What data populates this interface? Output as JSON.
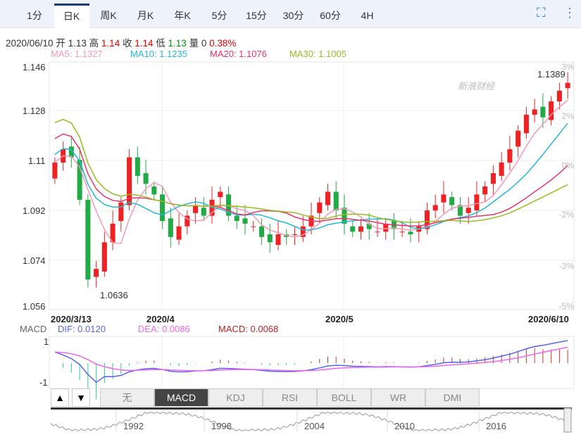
{
  "tabs": [
    "1分",
    "日K",
    "周K",
    "月K",
    "年K",
    "5分",
    "15分",
    "30分",
    "60分",
    "4H"
  ],
  "active_tab": "日K",
  "info": {
    "date": "2020/06/10",
    "open_label": "开",
    "open": "1.13",
    "high_label": "高",
    "high": "1.14",
    "close_label": "收",
    "close": "1.14",
    "low_label": "低",
    "low": "1.13",
    "vol_label": "量",
    "vol": "0",
    "change": "0.38%"
  },
  "ma": {
    "ma5": "MA5: 1.1327",
    "ma10": "MA10: 1.1235",
    "ma20": "MA20: 1.1076",
    "ma30": "MA30: 1.1005"
  },
  "watermark": "新浪财经",
  "colors": {
    "up": "#ee2222",
    "down": "#22aa44",
    "ma5": "#f49ab8",
    "ma10": "#22b8d8",
    "ma20": "#e8336a",
    "ma30": "#99bb22",
    "dif": "#5566ee",
    "dea": "#ee66ee"
  },
  "macd": {
    "label": "MACD",
    "dif": "DIF: 0.0120",
    "dea": "DEA: 0.0086",
    "macd": "MACD: 0.0068",
    "tick_top": "1",
    "tick_bottom": "-1"
  },
  "indicator_tabs": [
    "无",
    "MACD",
    "KDJ",
    "RSI",
    "BOLL",
    "WR",
    "DMI"
  ],
  "nav_years": [
    "1992",
    "1998",
    "2004",
    "2010",
    "2016"
  ],
  "chart_data": {
    "type": "candlestick",
    "y_ticks": [
      "1.146",
      "1.128",
      "1.11",
      "1.092",
      "1.074",
      "1.056"
    ],
    "y_pct_ticks": [
      "3%",
      "2%",
      "0%",
      "-2%",
      "-3%",
      "-5%"
    ],
    "ylim": [
      1.056,
      1.146
    ],
    "x_labels": [
      "2020/3/13",
      "2020/4",
      "2020/5",
      "2020/6/10"
    ],
    "max_label": "1.1389",
    "min_label": "1.0636",
    "closes": [
      1.11,
      1.115,
      1.112,
      1.096,
      1.066,
      1.07,
      1.08,
      1.087,
      1.095,
      1.112,
      1.105,
      1.102,
      1.098,
      1.088,
      1.082,
      1.086,
      1.09,
      1.094,
      1.09,
      1.096,
      1.099,
      1.09,
      1.088,
      1.087,
      1.086,
      1.082,
      1.08,
      1.083,
      1.082,
      1.083,
      1.086,
      1.09,
      1.095,
      1.099,
      1.092,
      1.087,
      1.084,
      1.086,
      1.085,
      1.084,
      1.087,
      1.085,
      1.084,
      1.083,
      1.086,
      1.092,
      1.094,
      1.098,
      1.094,
      1.09,
      1.093,
      1.098,
      1.101,
      1.106,
      1.11,
      1.115,
      1.122,
      1.128,
      1.13,
      1.127,
      1.133,
      1.137,
      1.14
    ]
  }
}
